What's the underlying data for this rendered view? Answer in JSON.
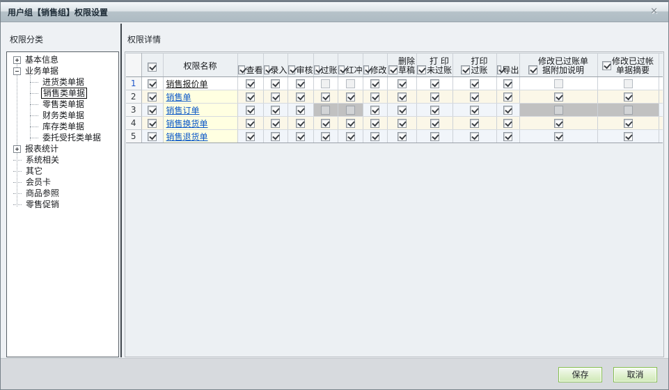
{
  "window": {
    "title": "用户组【销售组】权限设置",
    "close_icon": "✕"
  },
  "left_panel": {
    "header": "权限分类",
    "tree": [
      {
        "label": "基本信息",
        "level": 0,
        "expander": "plus",
        "selected": false
      },
      {
        "label": "业务单据",
        "level": 0,
        "expander": "minus",
        "selected": false
      },
      {
        "label": "进货类单据",
        "level": 1,
        "expander": "none",
        "selected": false
      },
      {
        "label": "销售类单据",
        "level": 1,
        "expander": "none",
        "selected": true
      },
      {
        "label": "零售类单据",
        "level": 1,
        "expander": "none",
        "selected": false
      },
      {
        "label": "财务类单据",
        "level": 1,
        "expander": "none",
        "selected": false
      },
      {
        "label": "库存类单据",
        "level": 1,
        "expander": "none",
        "selected": false
      },
      {
        "label": "委托受托类单据",
        "level": 1,
        "expander": "none",
        "selected": false
      },
      {
        "label": "报表统计",
        "level": 0,
        "expander": "plus",
        "selected": false
      },
      {
        "label": "系统相关",
        "level": 0,
        "expander": "none",
        "selected": false
      },
      {
        "label": "其它",
        "level": 0,
        "expander": "none",
        "selected": false
      },
      {
        "label": "会员卡",
        "level": 0,
        "expander": "none",
        "selected": false
      },
      {
        "label": "商品参照",
        "level": 0,
        "expander": "none",
        "selected": false
      },
      {
        "label": "零售促销",
        "level": 0,
        "expander": "none",
        "selected": false
      }
    ]
  },
  "right_panel": {
    "header": "权限详情",
    "table": {
      "name_header": "权限名称",
      "select_all": "checked",
      "columns": [
        {
          "top": "",
          "bottom": "查看",
          "check": "checked"
        },
        {
          "top": "",
          "bottom": "录入",
          "check": "checked"
        },
        {
          "top": "",
          "bottom": "审核",
          "check": "checked"
        },
        {
          "top": "",
          "bottom": "过账",
          "check": "checked"
        },
        {
          "top": "",
          "bottom": "红冲",
          "check": "checked"
        },
        {
          "top": "",
          "bottom": "修改",
          "check": "checked"
        },
        {
          "top": "删除",
          "bottom": "草稿",
          "check": "checked"
        },
        {
          "top": "打 印",
          "bottom": "未过账",
          "check": "checked"
        },
        {
          "top": "打印",
          "bottom": "过账",
          "check": "checked"
        },
        {
          "top": "",
          "bottom": "导出",
          "check": "checked"
        },
        {
          "top": "修改已过账单",
          "bottom": "据附加说明",
          "check": "checked"
        },
        {
          "top": "修改已过帐",
          "bottom": "单据摘要",
          "check": "checked"
        }
      ],
      "rows": [
        {
          "num": "1",
          "name": "销售报价单",
          "selected": true,
          "row_check": "checked",
          "cells": [
            "checked",
            "checked",
            "checked",
            "off",
            "off",
            "checked",
            "checked",
            "checked",
            "checked",
            "checked",
            "off",
            "off"
          ]
        },
        {
          "num": "2",
          "name": "销售单",
          "selected": false,
          "row_check": "checked",
          "cells": [
            "checked",
            "checked",
            "checked",
            "checked",
            "checked",
            "checked",
            "checked",
            "checked",
            "checked",
            "checked",
            "checked",
            "checked"
          ]
        },
        {
          "num": "3",
          "name": "销售订单",
          "selected": false,
          "row_check": "checked",
          "cells": [
            "checked",
            "checked",
            "checked",
            "disabled",
            "disabled",
            "checked",
            "checked",
            "checked",
            "checked",
            "checked",
            "disabled",
            "disabled"
          ]
        },
        {
          "num": "4",
          "name": "销售换货单",
          "selected": false,
          "row_check": "checked",
          "cells": [
            "checked",
            "checked",
            "checked",
            "checked",
            "checked",
            "checked",
            "checked",
            "checked",
            "checked",
            "checked",
            "checked",
            "checked"
          ]
        },
        {
          "num": "5",
          "name": "销售退货单",
          "selected": false,
          "row_check": "checked",
          "cells": [
            "checked",
            "checked",
            "checked",
            "checked",
            "checked",
            "checked",
            "checked",
            "checked",
            "checked",
            "checked",
            "checked",
            "checked"
          ]
        }
      ]
    }
  },
  "footer": {
    "save_label": "保存",
    "cancel_label": "取消"
  },
  "colors": {
    "titlebar_top": "#f4f8fa",
    "titlebar_bottom": "#aebbc3",
    "selected_row_bg": "#ffffff",
    "row_cream": "#fbf7e8",
    "row_blue": "#f1f5fa",
    "name_cell_yellow": "#ffffe1",
    "disabled_cell_grey": "#c1c1c1",
    "link_blue": "#0a57c8",
    "button_green_border": "#85bf4e"
  }
}
